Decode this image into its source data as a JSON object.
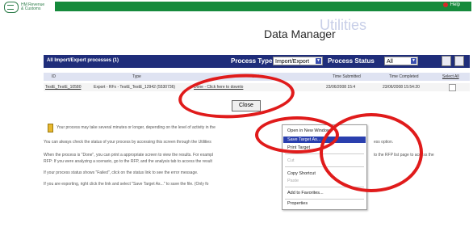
{
  "header": {
    "logo_line1": "HM Revenue",
    "logo_line2": "& Customs",
    "help_label": "Help"
  },
  "page": {
    "utilities": "Utilities",
    "title": "Data Manager"
  },
  "table": {
    "title": "All Import/Export processes (1)",
    "process_type_label": "Process Type",
    "process_type_value": "Import/Export",
    "process_status_label": "Process Status",
    "process_status_value": "All",
    "columns": [
      "ID",
      "Type",
      "Status",
      "Time Submitted",
      "Time Completed",
      "Select All"
    ],
    "row": {
      "id": "TestE_TestE_10580",
      "type": "Export - RFx - TestE_TestE_12942 (5530736)",
      "status": "Done - Click here to downlo",
      "submitted": "23/06/2008 15:4",
      "completed": "23/06/2008 15:54:20"
    }
  },
  "close_label": "Close",
  "paragraphs": [
    "Your process may take several minutes or longer, depending on the level of activity in the",
    "You can always check the status of your process by accessing this screen through the Utilities",
    "When the process is \"Done\", you can print a appropriate screen to view the results. For exampl",
    "RFP: If you were analyzing a scenario, go to the RFP, and the analysis tab to access the result",
    "If your process status shows \"Failed\", click on the status link to see the error message.",
    "If you are exporting, right click the link and select \"Save Target As...\" to save the file. (Only fo"
  ],
  "paragraph_tails": {
    "p2": "ess option.",
    "p3": "to the RFP list page to access the"
  },
  "context_menu": {
    "items": [
      "Open in New Window",
      "Save Target As...",
      "Print Target",
      "Cut",
      "Copy Shortcut",
      "Paste",
      "Add to Favorites...",
      "Properties"
    ],
    "highlighted": "Save Target As..."
  },
  "colors": {
    "green_bar": "#168a3c",
    "table_header": "#1f2d7a",
    "annotation_ring": "#e01b1b"
  }
}
